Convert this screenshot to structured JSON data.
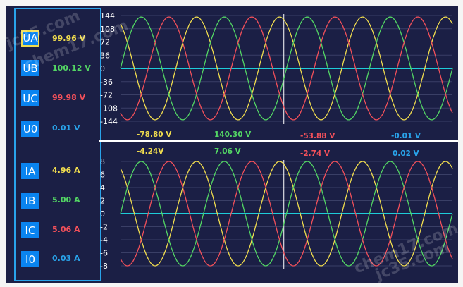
{
  "colors": {
    "phase_a": "#f0dc4e",
    "phase_b": "#53d664",
    "phase_c": "#f2505a",
    "zero": "#29a3ea",
    "baseline": "#1ecbd8",
    "background": "#1b1f45",
    "grid": "#3a3f66"
  },
  "voltage_channels": [
    {
      "label": "UA",
      "value": "99.96 V",
      "color": "#f0dc4e",
      "selected": true
    },
    {
      "label": "UB",
      "value": "100.12 V",
      "color": "#53d664",
      "selected": false
    },
    {
      "label": "UC",
      "value": "99.98 V",
      "color": "#f2505a",
      "selected": false
    },
    {
      "label": "U0",
      "value": "0.01 V",
      "color": "#29a3ea",
      "selected": false
    }
  ],
  "current_channels": [
    {
      "label": "IA",
      "value": "4.96 A",
      "color": "#f0dc4e"
    },
    {
      "label": "IB",
      "value": "5.00 A",
      "color": "#53d664"
    },
    {
      "label": "IC",
      "value": "5.06  A",
      "color": "#f2505a"
    },
    {
      "label": "I0",
      "value": "0.03 A",
      "color": "#29a3ea"
    }
  ],
  "voltage_readouts": [
    "-78.80 V",
    "140.30 V",
    "-53.88 V",
    "-0.01 V"
  ],
  "current_readouts": [
    "-4.24V",
    "7.06 V",
    "-2.74 V",
    "0.02 V"
  ],
  "watermarks": [
    "jc35.com",
    "chem17.com",
    "chem17.com",
    "jc35.com"
  ],
  "chart_data": [
    {
      "type": "line",
      "y_ticks": [
        "144",
        "108",
        "72",
        "36",
        "0",
        "-36",
        "-72",
        "-108",
        "-144"
      ],
      "ylim": [
        -144,
        144
      ],
      "amplitude": 140,
      "series": [
        {
          "name": "UA",
          "phase_deg": 120
        },
        {
          "name": "UB",
          "phase_deg": 0
        },
        {
          "name": "UC",
          "phase_deg": 240
        }
      ],
      "cursor_fraction": 0.492,
      "cycles": 4
    },
    {
      "type": "line",
      "y_ticks": [
        "8",
        "6",
        "4",
        "2",
        "0",
        "-2",
        "-4",
        "-6",
        "-8"
      ],
      "ylim": [
        -8,
        8
      ],
      "amplitude": 8,
      "series": [
        {
          "name": "IA",
          "phase_deg": 120
        },
        {
          "name": "IB",
          "phase_deg": 0
        },
        {
          "name": "IC",
          "phase_deg": 240
        }
      ],
      "cursor_fraction": 0.492,
      "cycles": 4
    }
  ]
}
